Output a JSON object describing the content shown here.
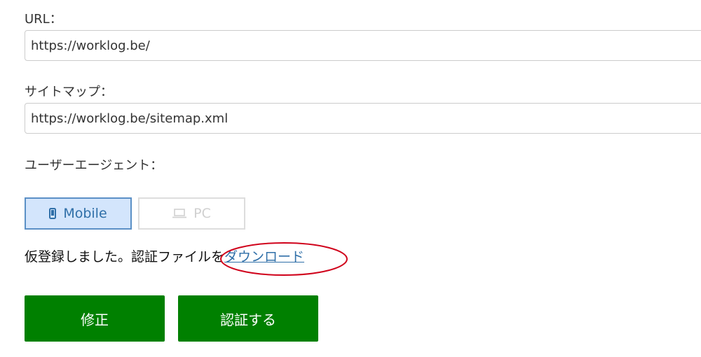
{
  "form": {
    "url": {
      "label": "URL：",
      "value": "https://worklog.be/"
    },
    "sitemap": {
      "label": "サイトマップ：",
      "value": "https://worklog.be/sitemap.xml"
    },
    "user_agent": {
      "label": "ユーザーエージェント：",
      "options": [
        {
          "label": "Mobile",
          "icon": "mobile-phone-icon",
          "selected": true
        },
        {
          "label": "PC",
          "icon": "laptop-icon",
          "selected": false
        }
      ]
    }
  },
  "notice": {
    "text": "仮登録しました。認証ファイルを",
    "link_label": "ダウンロード"
  },
  "actions": {
    "edit_label": "修正",
    "verify_label": "認証する"
  },
  "colors": {
    "primary_green": "#008000",
    "selected_bg": "#d3e5fc",
    "selected_border": "#5b90c6",
    "link": "#2f6fa8",
    "annotation": "#d0021b"
  }
}
